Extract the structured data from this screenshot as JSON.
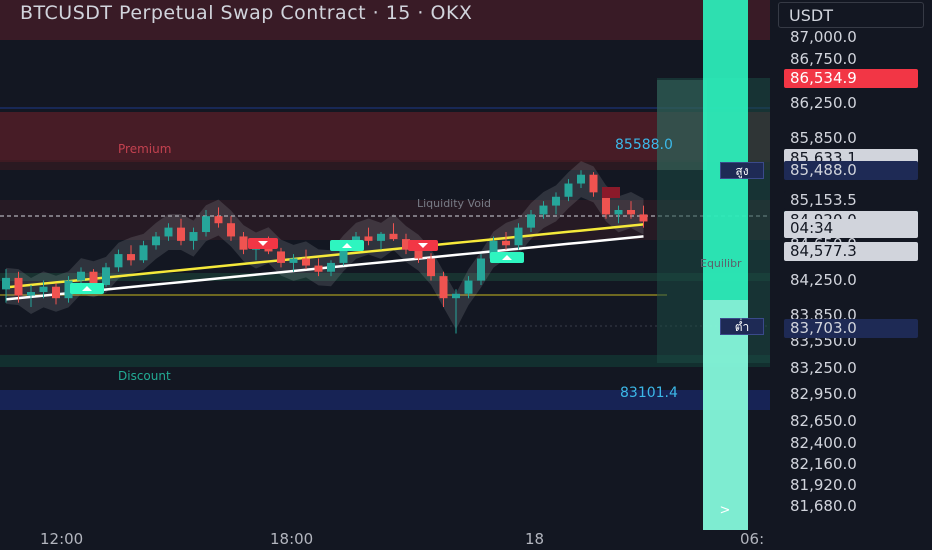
{
  "header": {
    "title": "BTCUSDT Perpetual Swap Contract · 15 · OKX",
    "currency": "USDT"
  },
  "price_axis": {
    "ticks": [
      {
        "label": "87,000.0",
        "value": 87000
      },
      {
        "label": "86,750.0",
        "value": 86750
      },
      {
        "label": "86,250.0",
        "value": 86250
      },
      {
        "label": "85,850.0",
        "value": 85850
      },
      {
        "label": "84,650.0",
        "value": 84650
      },
      {
        "label": "84,250.0",
        "value": 84250
      },
      {
        "label": "83,850.0",
        "value": 83850
      },
      {
        "label": "83,550.0",
        "value": 83550
      },
      {
        "label": "83,250.0",
        "value": 83250
      },
      {
        "label": "82,950.0",
        "value": 82950
      },
      {
        "label": "82,650.0",
        "value": 82650
      },
      {
        "label": "82,400.0",
        "value": 82400
      },
      {
        "label": "82,160.0",
        "value": 82160
      },
      {
        "label": "81,920.0",
        "value": 81920
      },
      {
        "label": "81,680.0",
        "value": 81680
      }
    ],
    "tags": [
      {
        "label": "86,534.9",
        "value": 86534.9,
        "bg": "#f23645",
        "fg": "#ffffff"
      },
      {
        "label": "85,633.1",
        "value": 85633.1,
        "bg": "#d1d4dc",
        "fg": "#131722"
      },
      {
        "label": "85,488.0",
        "value": 85488.0,
        "bg": "#1e2a55",
        "fg": "#d1d4dc"
      },
      {
        "label": "85,153.5",
        "value": 85153.5,
        "bg": "#131722",
        "fg": "#d1d4dc"
      },
      {
        "label": "84,920.1",
        "value": 84920.1,
        "bg": "#22ab94",
        "fg": "#ffffff"
      },
      {
        "label": "84,920.0",
        "value": 84920.0,
        "bg": "#d1d4dc",
        "fg": "#131722"
      },
      {
        "label": "04:34",
        "value": 84830,
        "bg": "#d1d4dc",
        "fg": "#131722"
      },
      {
        "label": "84,577.3",
        "value": 84577.3,
        "bg": "#d1d4dc",
        "fg": "#131722"
      },
      {
        "label": "83,703.0",
        "value": 83703.0,
        "bg": "#1e2a55",
        "fg": "#d1d4dc"
      }
    ],
    "high_tag": "สูง",
    "low_tag": "ต่ำ"
  },
  "time_axis": {
    "labels": [
      "12:00",
      "18:00",
      "18",
      "06:"
    ]
  },
  "zones": {
    "premium_label": "Premium",
    "premium_price": "85588.0",
    "discount_label": "Discount",
    "discount_price": "83101.4",
    "liquidity_label": "Liquidity Void",
    "equilibrium_label": "Equilibr"
  },
  "colors": {
    "bull": "#26a69a",
    "bear": "#ef5350",
    "accent_teal": "#2ef5c0",
    "premium": "#f23645",
    "discount": "#22ab94"
  },
  "scroll_button": ">",
  "candles": [
    [
      84150,
      84380,
      84000,
      84280
    ],
    [
      84280,
      84350,
      84000,
      84080
    ],
    [
      84080,
      84200,
      83950,
      84120
    ],
    [
      84120,
      84250,
      84050,
      84180
    ],
    [
      84180,
      84220,
      83980,
      84050
    ],
    [
      84050,
      84300,
      84000,
      84250
    ],
    [
      84250,
      84400,
      84200,
      84350
    ],
    [
      84350,
      84380,
      84150,
      84200
    ],
    [
      84200,
      84450,
      84180,
      84400
    ],
    [
      84400,
      84600,
      84350,
      84550
    ],
    [
      84550,
      84650,
      84420,
      84480
    ],
    [
      84480,
      84700,
      84450,
      84650
    ],
    [
      84650,
      84800,
      84600,
      84750
    ],
    [
      84750,
      84900,
      84700,
      84850
    ],
    [
      84850,
      84950,
      84650,
      84700
    ],
    [
      84700,
      84850,
      84600,
      84800
    ],
    [
      84800,
      85050,
      84750,
      84980
    ],
    [
      84980,
      85080,
      84850,
      84900
    ],
    [
      84900,
      84980,
      84700,
      84750
    ],
    [
      84750,
      84800,
      84550,
      84600
    ],
    [
      84600,
      84700,
      84480,
      84650
    ],
    [
      84650,
      84750,
      84550,
      84580
    ],
    [
      84580,
      84620,
      84400,
      84450
    ],
    [
      84450,
      84550,
      84350,
      84500
    ],
    [
      84500,
      84600,
      84380,
      84420
    ],
    [
      84420,
      84500,
      84300,
      84350
    ],
    [
      84350,
      84480,
      84300,
      84450
    ],
    [
      84450,
      84700,
      84420,
      84650
    ],
    [
      84650,
      84800,
      84600,
      84750
    ],
    [
      84750,
      84850,
      84650,
      84700
    ],
    [
      84700,
      84800,
      84600,
      84780
    ],
    [
      84780,
      84900,
      84700,
      84720
    ],
    [
      84720,
      84780,
      84550,
      84600
    ],
    [
      84600,
      84680,
      84450,
      84500
    ],
    [
      84500,
      84560,
      84250,
      84300
    ],
    [
      84300,
      84350,
      83950,
      84050
    ],
    [
      84050,
      84150,
      83650,
      84100
    ],
    [
      84100,
      84300,
      84050,
      84250
    ],
    [
      84250,
      84550,
      84200,
      84500
    ],
    [
      84500,
      84750,
      84450,
      84700
    ],
    [
      84700,
      84800,
      84600,
      84650
    ],
    [
      84650,
      84900,
      84600,
      84850
    ],
    [
      84850,
      85050,
      84800,
      85000
    ],
    [
      85000,
      85150,
      84950,
      85100
    ],
    [
      85100,
      85250,
      85000,
      85200
    ],
    [
      85200,
      85400,
      85150,
      85350
    ],
    [
      85350,
      85500,
      85300,
      85450
    ],
    [
      85450,
      85480,
      85200,
      85250
    ],
    [
      85250,
      85300,
      84950,
      85000
    ],
    [
      85000,
      85100,
      84900,
      85050
    ],
    [
      85050,
      85150,
      84950,
      85000
    ],
    [
      85000,
      85100,
      84850,
      84920
    ]
  ]
}
